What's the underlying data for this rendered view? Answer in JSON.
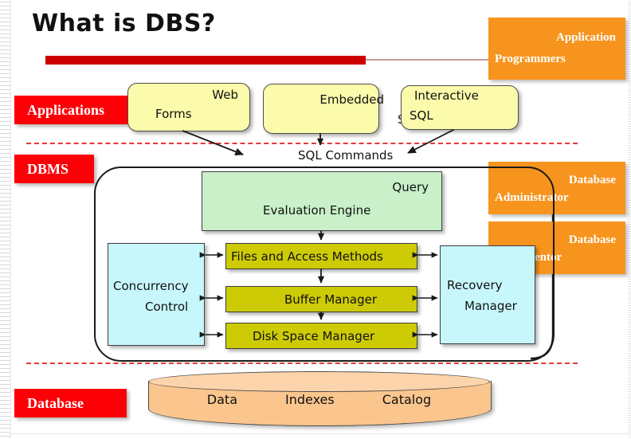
{
  "slide": {
    "title": "What is DBS?"
  },
  "labels": {
    "applications": "Applications",
    "dbms": "DBMS",
    "database": "Database",
    "sql_commands": "SQL Commands"
  },
  "actors": [
    {
      "id": "app-programmers",
      "line1": "Application",
      "line2": "Programmers"
    },
    {
      "id": "db-administrator",
      "line1": "Database",
      "line2": "Administrator"
    },
    {
      "id": "db-implementor",
      "line1": "Database",
      "line2": "Implementor"
    }
  ],
  "applications": [
    {
      "id": "web-forms",
      "line1": "Web",
      "line2": "Forms"
    },
    {
      "id": "embedded-sql",
      "line1": "Embedded",
      "line2": "SQL"
    },
    {
      "id": "interactive-sql",
      "line1": "Interactive",
      "line2": "SQL"
    }
  ],
  "dbms_components": {
    "query_engine": {
      "line1": "Query",
      "line2": "Evaluation Engine"
    },
    "concurrency": {
      "line1": "Concurrency",
      "line2": "Control"
    },
    "recovery": {
      "line1": "Recovery",
      "line2": "Manager"
    },
    "files_access": "Files and Access Methods",
    "buffer_manager": "Buffer Manager",
    "disk_space": "Disk Space Manager"
  },
  "database": {
    "items": [
      "Data",
      "Indexes",
      "Catalog"
    ]
  },
  "colors": {
    "red_chip": "#fb0007",
    "title_bar": "#cc0000",
    "orange": "#f7941e",
    "yellow": "#fbfbab",
    "green": "#c9f0c9",
    "cyan": "#c7f7fb",
    "olive": "#cdcb06",
    "cylinder": "#fbc68e",
    "dashed_line": "#e03a3a"
  }
}
